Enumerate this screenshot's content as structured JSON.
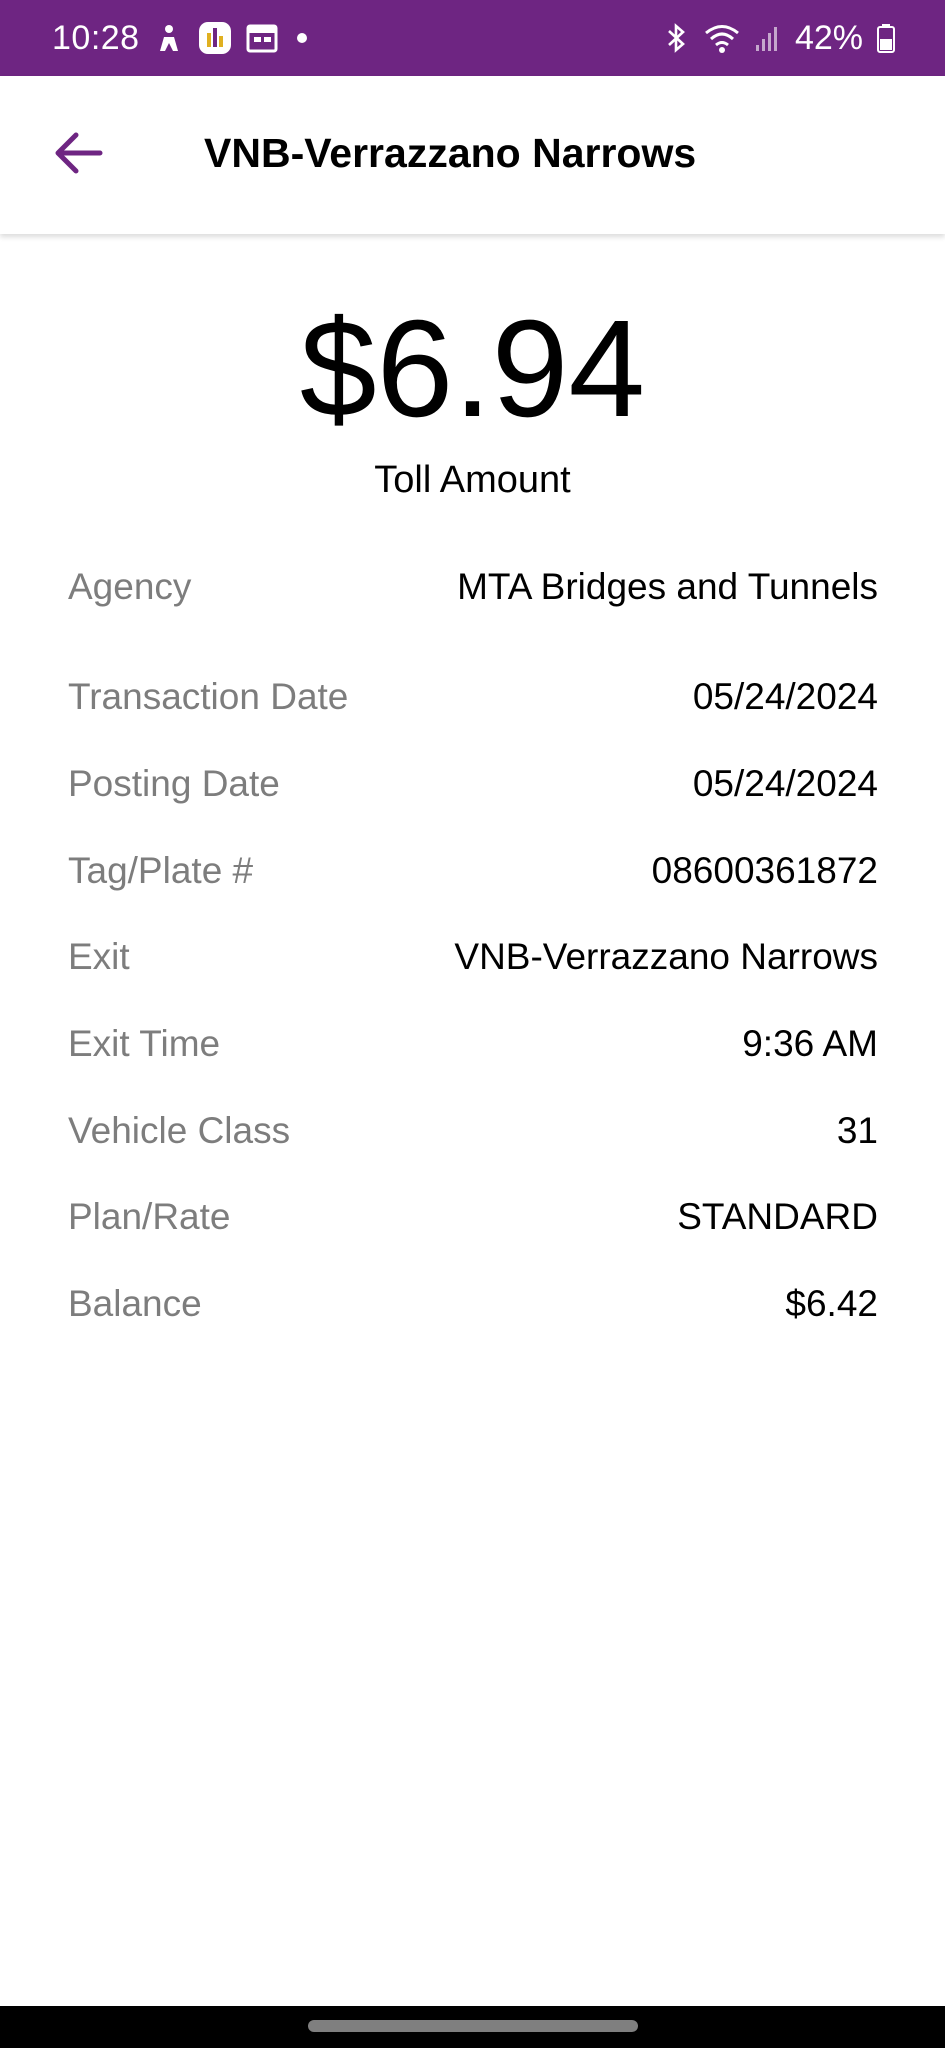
{
  "status_bar": {
    "time": "10:28",
    "battery_percent": "42%",
    "background_color": "#6e2582",
    "left_icons": [
      "accessibility-icon",
      "chart-app-icon",
      "calendar-icon",
      "dot-icon"
    ],
    "right_icons": [
      "bluetooth-icon",
      "wifi-icon",
      "signal-icon",
      "battery-icon"
    ]
  },
  "app_bar": {
    "title": "VNB-Verrazzano Narrows",
    "back_icon": "arrow-left-icon",
    "accent_color": "#6e2582"
  },
  "toll": {
    "amount": "$6.94",
    "label": "Toll Amount"
  },
  "details": [
    {
      "label": "Agency",
      "value": "MTA Bridges and Tunnels"
    },
    {
      "label": "Transaction Date",
      "value": "05/24/2024"
    },
    {
      "label": "Posting Date",
      "value": "05/24/2024"
    },
    {
      "label": "Tag/Plate #",
      "value": "08600361872"
    },
    {
      "label": "Exit",
      "value": "VNB-Verrazzano Narrows"
    },
    {
      "label": "Exit Time",
      "value": "9:36 AM"
    },
    {
      "label": "Vehicle Class",
      "value": "31"
    },
    {
      "label": "Plan/Rate",
      "value": "STANDARD"
    },
    {
      "label": "Balance",
      "value": "$6.42"
    }
  ]
}
